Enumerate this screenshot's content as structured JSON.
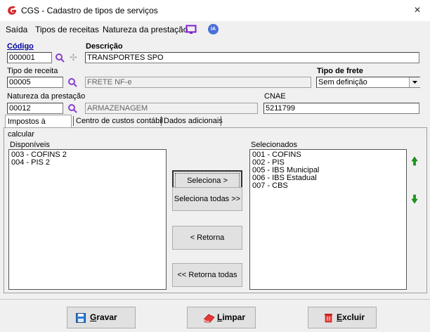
{
  "window": {
    "title": "CGS - Cadastro de tipos de serviços",
    "close": "×"
  },
  "menu": {
    "items": [
      "Saída",
      "Tipos de receitas",
      "Natureza da prestação"
    ],
    "ia_label": "IA"
  },
  "form": {
    "codigo_label": "Código",
    "codigo_value": "000001",
    "descricao_label": "Descrição",
    "descricao_value": "TRANSPORTES SPO",
    "tipo_receita_label": "Tipo de receita",
    "tipo_receita_code": "00005",
    "tipo_receita_desc": "FRETE NF-e",
    "tipo_frete_label": "Tipo de frete",
    "tipo_frete_value": "Sem definição",
    "natureza_label": "Natureza da prestação",
    "natureza_code": "00012",
    "natureza_desc": "ARMAZENAGEM",
    "cnae_label": "CNAE",
    "cnae_value": "5211799"
  },
  "tabs": [
    "Impostos à calcular",
    "Centro de custos contábil",
    "Dados adicionais"
  ],
  "impostos": {
    "disponiveis_label": "Disponíveis",
    "disponiveis": [
      "003 - COFINS 2",
      "004 - PIS 2"
    ],
    "selecionados_label": "Selecionados",
    "selecionados": [
      "001 - COFINS",
      "002 - PIS",
      "005 - IBS Municipal",
      "006 - IBS Estadual",
      "007 - CBS"
    ],
    "btn_seleciona": "Seleciona >",
    "btn_seleciona_todas": "Seleciona todas >>",
    "btn_retorna": "< Retorna",
    "btn_retorna_todas": "<< Retorna todas"
  },
  "actions": {
    "gravar_first": "G",
    "gravar_rest": "ravar",
    "limpar_first": "L",
    "limpar_rest": "impar",
    "excluir_first": "E",
    "excluir_rest": "xcluir"
  },
  "colors": {
    "accent_blue": "#0000a0",
    "logo_red": "#d32f2f",
    "arrow_green": "#1a9a1a",
    "magnifier_purple": "#8a3fd1"
  }
}
